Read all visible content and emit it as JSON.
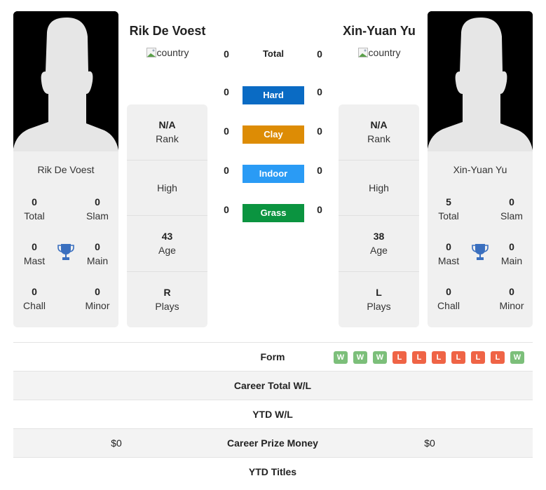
{
  "players": [
    {
      "name": "Rik De Voest",
      "country_alt": "country",
      "titles": {
        "total": "0",
        "slam": "0",
        "mast": "0",
        "main": "0",
        "chall": "0",
        "minor": "0"
      },
      "info": {
        "rank": "N/A",
        "high": "High",
        "age": "43",
        "plays": "R"
      }
    },
    {
      "name": "Xin-Yuan Yu",
      "country_alt": "country",
      "titles": {
        "total": "5",
        "slam": "0",
        "mast": "0",
        "main": "0",
        "chall": "0",
        "minor": "0"
      },
      "info": {
        "rank": "N/A",
        "high": "High",
        "age": "38",
        "plays": "L"
      }
    }
  ],
  "labels": {
    "total": "Total",
    "slam": "Slam",
    "mast": "Mast",
    "main": "Main",
    "chall": "Chall",
    "minor": "Minor",
    "rank": "Rank",
    "age": "Age",
    "plays": "Plays"
  },
  "surfaces": [
    {
      "name": "Total",
      "left": "0",
      "right": "0",
      "color": ""
    },
    {
      "name": "Hard",
      "left": "0",
      "right": "0",
      "color": "#0a6bc4"
    },
    {
      "name": "Clay",
      "left": "0",
      "right": "0",
      "color": "#dd8c05"
    },
    {
      "name": "Indoor",
      "left": "0",
      "right": "0",
      "color": "#2a9bf5"
    },
    {
      "name": "Grass",
      "left": "0",
      "right": "0",
      "color": "#0b9440"
    }
  ],
  "comparison": {
    "form_label": "Form",
    "form": [
      "W",
      "W",
      "W",
      "L",
      "L",
      "L",
      "L",
      "L",
      "L",
      "W"
    ],
    "rows": [
      {
        "label": "Career Total W/L",
        "left": "",
        "right": ""
      },
      {
        "label": "YTD W/L",
        "left": "",
        "right": ""
      },
      {
        "label": "Career Prize Money",
        "left": "$0",
        "right": "$0"
      },
      {
        "label": "YTD Titles",
        "left": "",
        "right": ""
      }
    ]
  },
  "colors": {
    "win": "#7cbf7a",
    "loss": "#ef6446",
    "trophy": "#3a6fbf"
  }
}
